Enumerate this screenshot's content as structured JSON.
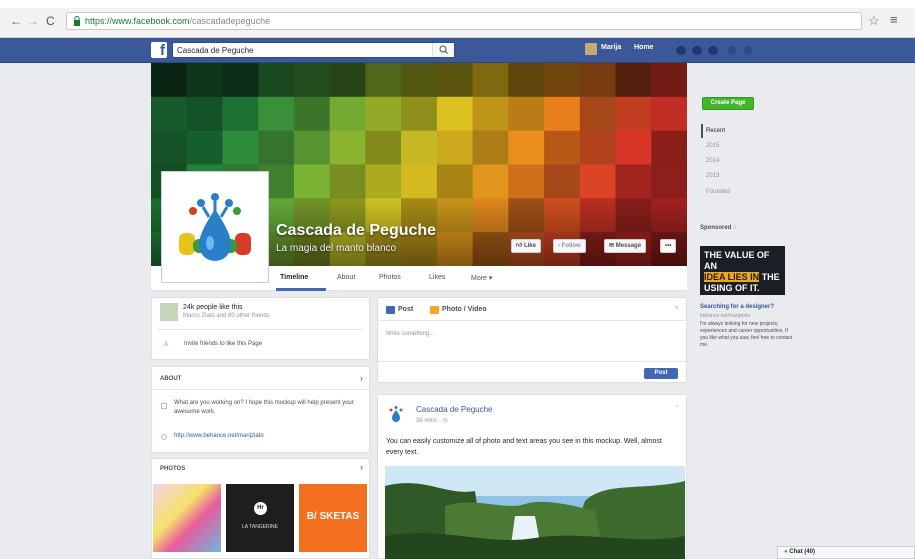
{
  "browser": {
    "url_host": "https://www.facebook.com",
    "url_path": "/cascadadepeguche"
  },
  "fb": {
    "logo": "f",
    "search_value": "Cascada de Peguche",
    "user_name": "Marija",
    "home_label": "Home"
  },
  "page": {
    "name": "Cascada de Peguche",
    "subtitle": "La magia del manto blanco",
    "buttons": {
      "like": "Like",
      "follow": "Follow",
      "message": "Message",
      "more": "•••"
    }
  },
  "tabs": [
    "Timeline",
    "About",
    "Photos",
    "Likes",
    "More ▾"
  ],
  "likes_card": {
    "count": "24k people like this",
    "friends": "Marco Zlato and 80 other friends",
    "invite": "Invite friends to like this Page"
  },
  "about": {
    "header": "ABOUT",
    "description": "What are you working on? I hope this mockup will help present your awesome work.",
    "link": "http://www.behance.net/marijzlato"
  },
  "photos": {
    "header": "PHOTOS",
    "tile2": "LA TANGERINE",
    "tile3": "B/ SKETAS"
  },
  "composer": {
    "post_tab": "Post",
    "photo_tab": "Photo / Video",
    "placeholder": "Write something...",
    "post_button": "Post"
  },
  "post": {
    "author": "Cascada de Peguche",
    "time": "38 mins · ◷",
    "text": "You can easily customize all of photo and text areas you see in this mockup. Well, almost every text."
  },
  "right": {
    "create_page": "Create Page",
    "years": [
      "Recent",
      "2015",
      "2014",
      "2013",
      "Founded"
    ],
    "sponsored": "Sponsored ◌",
    "ad_line1": "THE VALUE OF AN",
    "ad_hl": "IDEA LIES IN",
    "ad_line2": " THE",
    "ad_line3": "USING OF IT.",
    "ad_title": "Searching for a designer?",
    "ad_link": "behance.net/marijzlato",
    "ad_body": "I'm always looking for new projects, experiences and career opportunities. If you like what you saw, feel free to contact me.",
    "chat": "Chat (40)"
  },
  "colors": {
    "fb_blue": "#3b5998",
    "green": "#42b72a",
    "link": "#4267b2"
  }
}
